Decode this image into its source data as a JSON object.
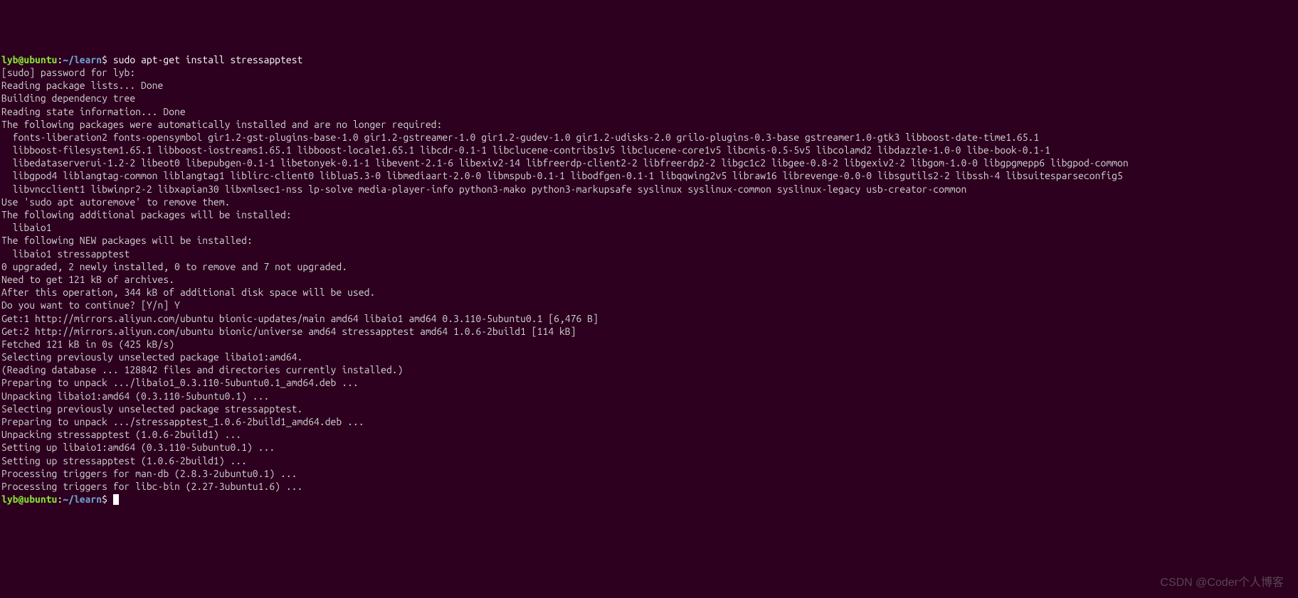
{
  "prompt1": {
    "user": "lyb@ubuntu",
    "colon": ":",
    "path": "~/learn",
    "dollar": "$",
    "command": " sudo apt-get install stressapptest"
  },
  "lines": [
    "[sudo] password for lyb:",
    "Reading package lists... Done",
    "Building dependency tree",
    "Reading state information... Done",
    "The following packages were automatically installed and are no longer required:",
    "  fonts-liberation2 fonts-opensymbol gir1.2-gst-plugins-base-1.0 gir1.2-gstreamer-1.0 gir1.2-gudev-1.0 gir1.2-udisks-2.0 grilo-plugins-0.3-base gstreamer1.0-gtk3 libboost-date-time1.65.1",
    "  libboost-filesystem1.65.1 libboost-iostreams1.65.1 libboost-locale1.65.1 libcdr-0.1-1 libclucene-contribs1v5 libclucene-core1v5 libcmis-0.5-5v5 libcolamd2 libdazzle-1.0-0 libe-book-0.1-1",
    "  libedataserverui-1.2-2 libeot0 libepubgen-0.1-1 libetonyek-0.1-1 libevent-2.1-6 libexiv2-14 libfreerdp-client2-2 libfreerdp2-2 libgc1c2 libgee-0.8-2 libgexiv2-2 libgom-1.0-0 libgpgmepp6 libgpod-common",
    "  libgpod4 liblangtag-common liblangtag1 liblirc-client0 liblua5.3-0 libmediaart-2.0-0 libmspub-0.1-1 libodfgen-0.1-1 libqqwing2v5 libraw16 librevenge-0.0-0 libsgutils2-2 libssh-4 libsuitesparseconfig5",
    "  libvncclient1 libwinpr2-2 libxapian30 libxmlsec1-nss lp-solve media-player-info python3-mako python3-markupsafe syslinux syslinux-common syslinux-legacy usb-creator-common",
    "Use 'sudo apt autoremove' to remove them.",
    "The following additional packages will be installed:",
    "  libaio1",
    "The following NEW packages will be installed:",
    "  libaio1 stressapptest",
    "0 upgraded, 2 newly installed, 0 to remove and 7 not upgraded.",
    "Need to get 121 kB of archives.",
    "After this operation, 344 kB of additional disk space will be used.",
    "Do you want to continue? [Y/n] Y",
    "Get:1 http://mirrors.aliyun.com/ubuntu bionic-updates/main amd64 libaio1 amd64 0.3.110-5ubuntu0.1 [6,476 B]",
    "Get:2 http://mirrors.aliyun.com/ubuntu bionic/universe amd64 stressapptest amd64 1.0.6-2build1 [114 kB]",
    "Fetched 121 kB in 0s (425 kB/s)",
    "Selecting previously unselected package libaio1:amd64.",
    "(Reading database ... 128842 files and directories currently installed.)",
    "Preparing to unpack .../libaio1_0.3.110-5ubuntu0.1_amd64.deb ...",
    "Unpacking libaio1:amd64 (0.3.110-5ubuntu0.1) ...",
    "Selecting previously unselected package stressapptest.",
    "Preparing to unpack .../stressapptest_1.0.6-2build1_amd64.deb ...",
    "Unpacking stressapptest (1.0.6-2build1) ...",
    "Setting up libaio1:amd64 (0.3.110-5ubuntu0.1) ...",
    "Setting up stressapptest (1.0.6-2build1) ...",
    "Processing triggers for man-db (2.8.3-2ubuntu0.1) ...",
    "Processing triggers for libc-bin (2.27-3ubuntu1.6) ..."
  ],
  "prompt2": {
    "user": "lyb@ubuntu",
    "colon": ":",
    "path": "~/learn",
    "dollar": "$",
    "command": " "
  },
  "watermark": "CSDN @Coder个人博客"
}
